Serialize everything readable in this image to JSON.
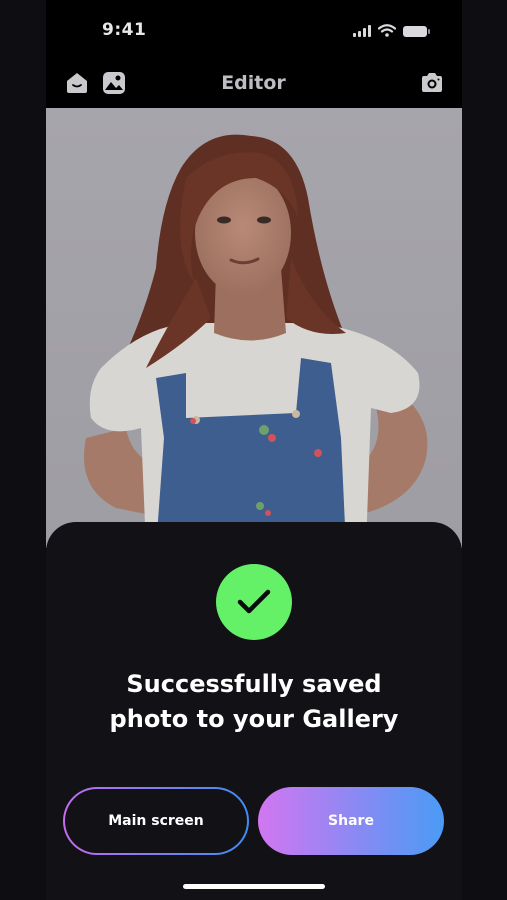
{
  "status_bar": {
    "time": "9:41"
  },
  "header": {
    "title": "Editor",
    "left_icons": [
      "home-icon",
      "gallery-icon"
    ],
    "right_icon": "camera-icon"
  },
  "photo": {
    "subject": "portrait-photo"
  },
  "success_sheet": {
    "icon": "checkmark-icon",
    "message_line1": "Successfully saved",
    "message_line2": "photo to your Gallery"
  },
  "actions": {
    "main_screen_label": "Main screen",
    "share_label": "Share"
  },
  "colors": {
    "accent_green": "#64f168",
    "gradient_start": "#d276f1",
    "gradient_end": "#4a9bf5",
    "background": "#000000"
  }
}
